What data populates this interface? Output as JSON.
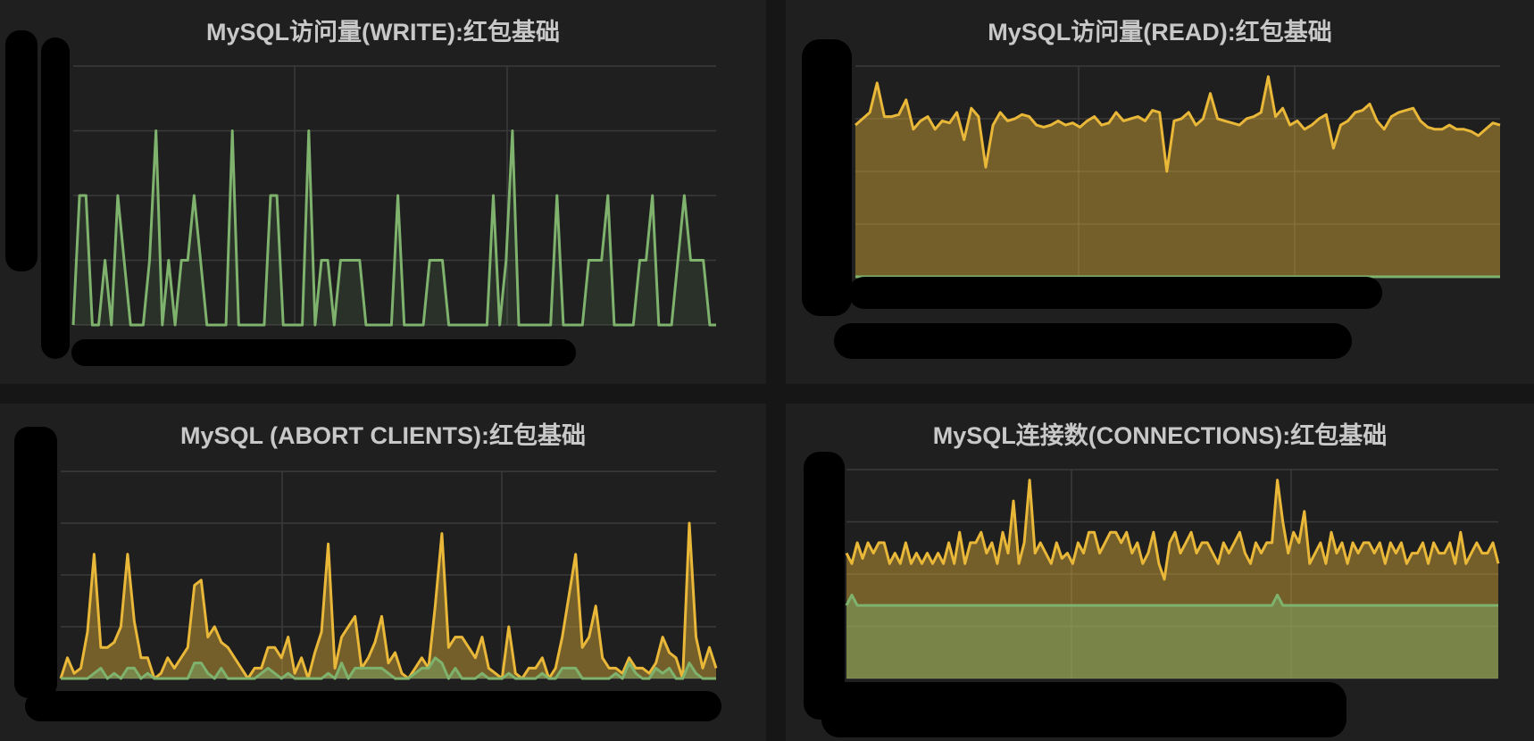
{
  "colors": {
    "green": "#7eb26d",
    "yellow": "#eab839",
    "grid": "#3a3a3a",
    "panel_bg": "#1f1f1f"
  },
  "chart_data": [
    {
      "type": "line",
      "title": "MySQL访问量(WRITE):红包基础",
      "ylim": [
        0,
        4
      ],
      "grid": true,
      "series": [
        {
          "color": "#7eb26d",
          "fill": true,
          "values": [
            0,
            2,
            2,
            0,
            0,
            1,
            0,
            2,
            1,
            0,
            0,
            0,
            1,
            3,
            0,
            1,
            0,
            1,
            1,
            2,
            1,
            0,
            0,
            0,
            0,
            3,
            0,
            0,
            0,
            0,
            0,
            2,
            2,
            0,
            0,
            0,
            0,
            3,
            0,
            1,
            1,
            0,
            1,
            1,
            1,
            1,
            0,
            0,
            0,
            0,
            0,
            2,
            0,
            0,
            0,
            0,
            1,
            1,
            1,
            0,
            0,
            0,
            0,
            0,
            0,
            0,
            2,
            0,
            1,
            3,
            0,
            0,
            0,
            0,
            0,
            0,
            2,
            0,
            0,
            0,
            0,
            1,
            1,
            1,
            2,
            0,
            0,
            0,
            0,
            1,
            1,
            2,
            0,
            0,
            0,
            1,
            2,
            1,
            1,
            1,
            0,
            0
          ]
        }
      ]
    },
    {
      "type": "area",
      "title": "MySQL访问量(READ):红包基础",
      "ylim": [
        0,
        100
      ],
      "grid": true,
      "series": [
        {
          "color": "#eab839",
          "fill": true,
          "values": [
            72,
            75,
            78,
            92,
            76,
            76,
            77,
            84,
            70,
            74,
            76,
            70,
            74,
            73,
            78,
            65,
            80,
            76,
            52,
            72,
            78,
            74,
            75,
            77,
            76,
            72,
            71,
            72,
            74,
            72,
            73,
            71,
            74,
            76,
            72,
            73,
            78,
            74,
            75,
            76,
            74,
            79,
            78,
            50,
            74,
            75,
            78,
            72,
            75,
            87,
            75,
            74,
            73,
            72,
            75,
            76,
            78,
            95,
            76,
            80,
            72,
            74,
            70,
            72,
            75,
            77,
            61,
            72,
            74,
            78,
            79,
            82,
            74,
            70,
            76,
            78,
            79,
            80,
            74,
            71,
            70,
            70,
            72,
            70,
            70,
            69,
            67,
            70,
            73,
            72
          ]
        },
        {
          "color": "#7eb26d",
          "fill": true,
          "values": [
            0,
            0,
            0,
            0,
            0,
            0,
            0,
            0,
            0,
            0,
            0,
            0,
            0,
            0,
            0,
            0,
            0,
            0,
            0,
            0,
            0,
            0,
            0,
            0,
            0,
            0,
            0,
            0,
            0,
            0,
            0,
            0,
            0,
            0,
            0,
            0,
            0,
            0,
            0,
            0,
            0,
            0,
            0,
            0,
            0,
            0,
            0,
            0,
            0,
            0,
            0,
            0,
            0,
            0,
            0,
            0,
            0,
            0,
            0,
            0,
            0,
            0,
            0,
            0,
            0,
            0,
            0,
            0,
            0,
            0,
            0,
            0,
            0,
            0,
            0,
            0,
            0,
            0,
            0,
            0,
            0,
            0,
            0,
            0,
            0,
            0,
            0,
            0,
            0,
            0
          ]
        }
      ]
    },
    {
      "type": "area",
      "title": "MySQL (ABORT CLIENTS):红包基础",
      "ylim": [
        0,
        4
      ],
      "grid": true,
      "series": [
        {
          "color": "#eab839",
          "fill": true,
          "values": [
            0,
            0.4,
            0.1,
            0.2,
            0.9,
            2.4,
            0.6,
            0.6,
            0.7,
            1.0,
            2.4,
            1.1,
            0.4,
            0.4,
            0,
            0.1,
            0.4,
            0.2,
            0.4,
            0.6,
            1.8,
            1.9,
            0.8,
            1.0,
            0.7,
            0.6,
            0.4,
            0.2,
            0,
            0.2,
            0.2,
            0.6,
            0.6,
            0.4,
            0.8,
            0.1,
            0.4,
            0,
            0.5,
            0.9,
            2.6,
            0.2,
            0.8,
            1.0,
            1.2,
            0.2,
            0.4,
            0.7,
            1.2,
            0.3,
            0.5,
            0.1,
            0,
            0.2,
            0.4,
            0.2,
            1.4,
            2.8,
            0.6,
            0.8,
            0.8,
            0.6,
            0.4,
            0.8,
            0.2,
            0.1,
            0,
            1.0,
            0.1,
            0,
            0.2,
            0.2,
            0.4,
            0,
            0.2,
            0.8,
            1.6,
            2.4,
            0.6,
            0.8,
            1.4,
            0.4,
            0.2,
            0.2,
            0.1,
            0.4,
            0.2,
            0.2,
            0.1,
            0.3,
            0.8,
            0.5,
            0.4,
            0,
            3.0,
            0.8,
            0.2,
            0.6,
            0.2
          ]
        },
        {
          "color": "#7eb26d",
          "fill": true,
          "values": [
            0,
            0,
            0,
            0,
            0,
            0.1,
            0.2,
            0,
            0.1,
            0,
            0.2,
            0.2,
            0,
            0.1,
            0,
            0,
            0,
            0,
            0,
            0,
            0.3,
            0.3,
            0.1,
            0,
            0.2,
            0,
            0,
            0,
            0,
            0,
            0.1,
            0.2,
            0.1,
            0,
            0.1,
            0,
            0,
            0,
            0,
            0,
            0.1,
            0,
            0.3,
            0,
            0.2,
            0.2,
            0.2,
            0.2,
            0.2,
            0.1,
            0,
            0,
            0,
            0.1,
            0.2,
            0.2,
            0.4,
            0.3,
            0,
            0.2,
            0,
            0,
            0,
            0.1,
            0,
            0,
            0,
            0.1,
            0,
            0,
            0,
            0,
            0.1,
            0,
            0,
            0.2,
            0.2,
            0.2,
            0,
            0,
            0,
            0,
            0,
            0.1,
            0,
            0.3,
            0.1,
            0,
            0,
            0.2,
            0.1,
            0.2,
            0,
            0,
            0.3,
            0.1,
            0,
            0,
            0
          ]
        }
      ]
    },
    {
      "type": "area",
      "title": "MySQL连接数(CONNECTIONS):红包基础",
      "ylim": [
        0,
        4
      ],
      "grid": true,
      "series": [
        {
          "color": "#eab839",
          "fill": true,
          "values": [
            2.4,
            2.2,
            2.6,
            2.3,
            2.6,
            2.4,
            2.6,
            2.6,
            2.2,
            2.4,
            2.2,
            2.6,
            2.2,
            2.4,
            2.2,
            2.4,
            2.2,
            2.4,
            2.2,
            2.6,
            2.2,
            2.8,
            2.2,
            2.6,
            2.6,
            2.8,
            2.4,
            2.6,
            2.2,
            2.8,
            2.4,
            3.4,
            2.2,
            2.6,
            3.8,
            2.4,
            2.6,
            2.4,
            2.2,
            2.6,
            2.3,
            2.4,
            2.2,
            2.6,
            2.4,
            2.8,
            2.8,
            2.4,
            2.6,
            2.8,
            2.8,
            2.6,
            2.8,
            2.4,
            2.6,
            2.2,
            2.4,
            2.8,
            2.2,
            1.9,
            2.6,
            2.8,
            2.4,
            2.6,
            2.8,
            2.4,
            2.6,
            2.6,
            2.4,
            2.2,
            2.6,
            2.4,
            2.6,
            2.8,
            2.4,
            2.2,
            2.6,
            2.4,
            2.6,
            2.6,
            3.8,
            3.0,
            2.4,
            2.8,
            2.6,
            3.2,
            2.2,
            2.4,
            2.6,
            2.2,
            2.8,
            2.4,
            2.6,
            2.2,
            2.6,
            2.4,
            2.6,
            2.6,
            2.4,
            2.6,
            2.2,
            2.6,
            2.4,
            2.6,
            2.2,
            2.4,
            2.4,
            2.6,
            2.2,
            2.6,
            2.4,
            2.4,
            2.6,
            2.2,
            2.8,
            2.2,
            2.4,
            2.6,
            2.4,
            2.4,
            2.6,
            2.2
          ]
        },
        {
          "color": "#7eb26d",
          "fill": true,
          "values": [
            1.4,
            1.6,
            1.4,
            1.4,
            1.4,
            1.4,
            1.4,
            1.4,
            1.4,
            1.4,
            1.4,
            1.4,
            1.4,
            1.4,
            1.4,
            1.4,
            1.4,
            1.4,
            1.4,
            1.4,
            1.4,
            1.4,
            1.4,
            1.4,
            1.4,
            1.4,
            1.4,
            1.4,
            1.4,
            1.4,
            1.4,
            1.4,
            1.4,
            1.4,
            1.4,
            1.4,
            1.4,
            1.4,
            1.4,
            1.4,
            1.4,
            1.4,
            1.4,
            1.4,
            1.4,
            1.4,
            1.4,
            1.4,
            1.4,
            1.4,
            1.4,
            1.4,
            1.4,
            1.4,
            1.4,
            1.4,
            1.4,
            1.4,
            1.4,
            1.4,
            1.4,
            1.4,
            1.4,
            1.4,
            1.4,
            1.4,
            1.4,
            1.4,
            1.4,
            1.4,
            1.4,
            1.4,
            1.4,
            1.4,
            1.4,
            1.4,
            1.4,
            1.4,
            1.4,
            1.4,
            1.6,
            1.4,
            1.4,
            1.4,
            1.4,
            1.4,
            1.4,
            1.4,
            1.4,
            1.4,
            1.4,
            1.4,
            1.4,
            1.4,
            1.4,
            1.4,
            1.4,
            1.4,
            1.4,
            1.4,
            1.4,
            1.4,
            1.4,
            1.4,
            1.4,
            1.4,
            1.4,
            1.4,
            1.4,
            1.4,
            1.4,
            1.4,
            1.4,
            1.4,
            1.4,
            1.4,
            1.4,
            1.4,
            1.4,
            1.4,
            1.4,
            1.4
          ]
        }
      ]
    }
  ]
}
